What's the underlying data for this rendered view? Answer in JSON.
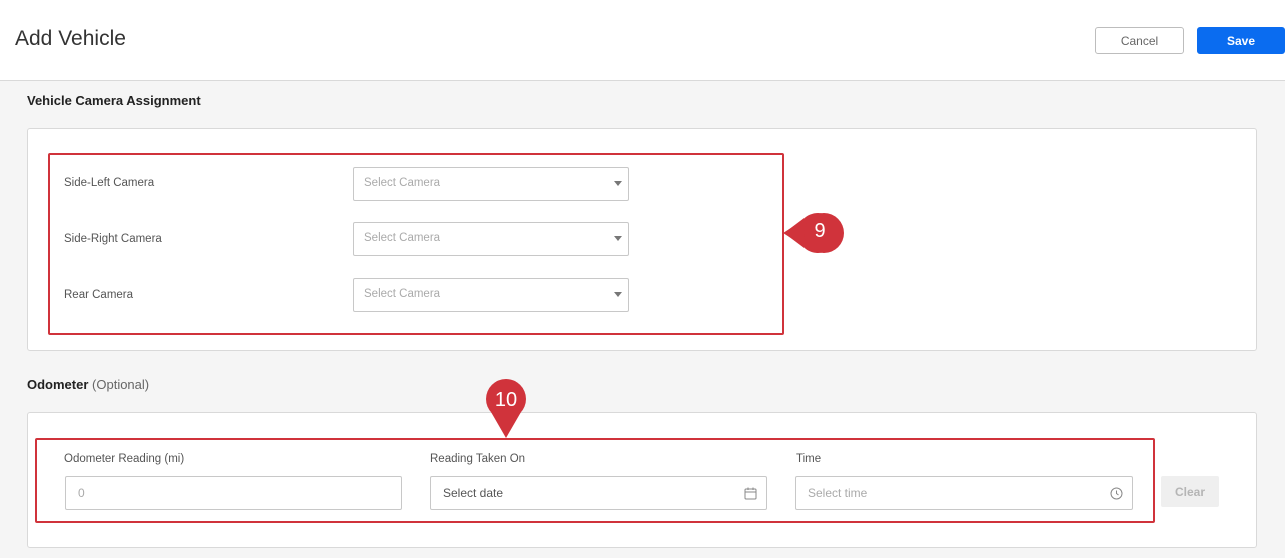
{
  "header": {
    "title": "Add Vehicle",
    "cancel_label": "Cancel",
    "save_label": "Save"
  },
  "camera_section": {
    "title": "Vehicle Camera Assignment",
    "fields": [
      {
        "label": "Side-Left Camera",
        "placeholder": "Select Camera"
      },
      {
        "label": "Side-Right Camera",
        "placeholder": "Select Camera"
      },
      {
        "label": "Rear Camera",
        "placeholder": "Select Camera"
      }
    ]
  },
  "odometer_section": {
    "title": "Odometer",
    "optional": "(Optional)",
    "reading_label": "Odometer Reading (mi)",
    "reading_placeholder": "0",
    "date_label": "Reading Taken On",
    "date_placeholder": "Select date",
    "time_label": "Time",
    "time_placeholder": "Select time",
    "clear_label": "Clear"
  },
  "callouts": {
    "camera": "9",
    "odometer": "10"
  },
  "colors": {
    "accent": "#0a6cf0",
    "callout": "#d0333b"
  },
  "icons": [
    "caret-down-icon",
    "calendar-icon",
    "clock-icon"
  ]
}
